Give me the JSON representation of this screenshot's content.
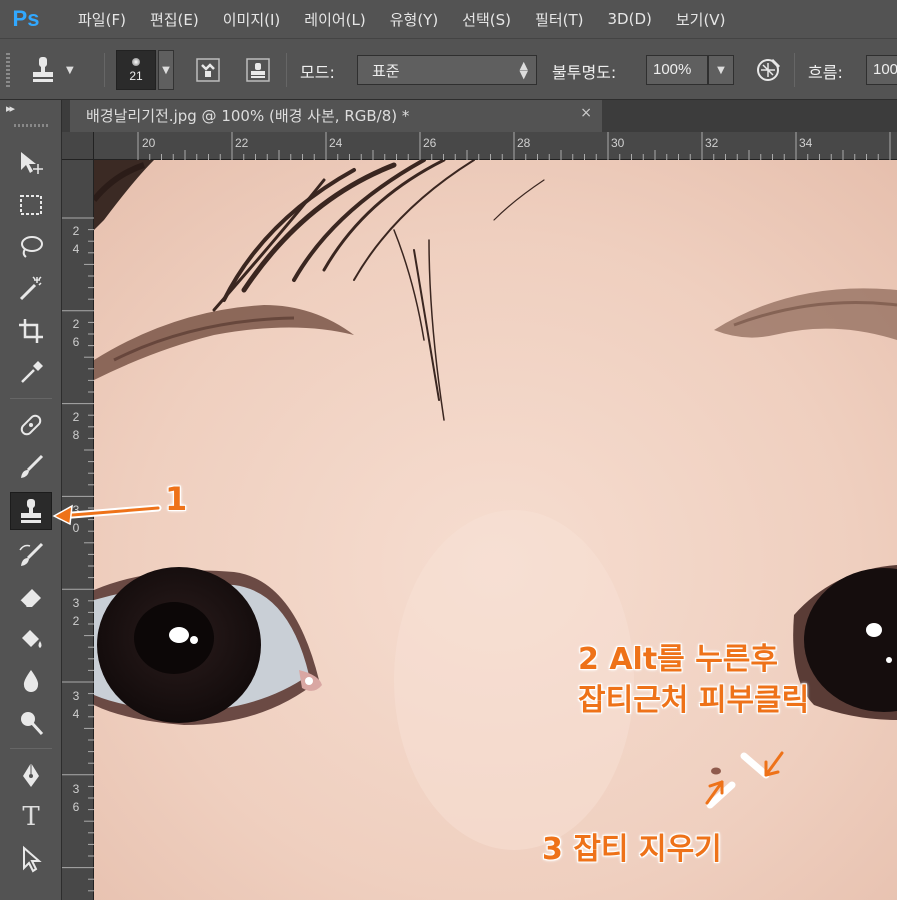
{
  "app": {
    "logo": "Ps"
  },
  "menu": [
    "파일(F)",
    "편집(E)",
    "이미지(I)",
    "레이어(L)",
    "유형(Y)",
    "선택(S)",
    "필터(T)",
    "3D(D)",
    "보기(V)"
  ],
  "options": {
    "brush_size": "21",
    "mode_label": "모드:",
    "mode_value": "표준",
    "opacity_label": "불투명도:",
    "opacity_value": "100%",
    "flow_label": "흐름:",
    "flow_value": "100"
  },
  "document": {
    "tab_title": "배경날리기전.jpg @ 100% (배경 사본, RGB/8) *",
    "close_glyph": "×"
  },
  "ruler": {
    "top": [
      "20",
      "22",
      "24",
      "26",
      "28",
      "30",
      "32",
      "34"
    ],
    "left": [
      "24",
      "26",
      "28",
      "30",
      "32",
      "34",
      "36"
    ]
  },
  "tools": [
    "move-tool",
    "marquee-tool",
    "lasso-tool",
    "magic-wand-tool",
    "crop-tool",
    "eyedropper-tool",
    "healing-brush-tool",
    "brush-tool",
    "clone-stamp-tool",
    "history-brush-tool",
    "eraser-tool",
    "paint-bucket-tool",
    "blur-tool",
    "dodge-tool",
    "pen-tool",
    "type-tool",
    "path-selection-tool"
  ],
  "tool_text": {
    "type": "T"
  },
  "annotations": {
    "step1": "1",
    "step2_line1": "2 Alt를 누른후",
    "step2_line2": "잡티근처 피부클릭",
    "step3": "3 잡티 지우기"
  },
  "colors": {
    "accent": "#ee7219",
    "ps_blue": "#31a8ff",
    "panel": "#535353"
  }
}
